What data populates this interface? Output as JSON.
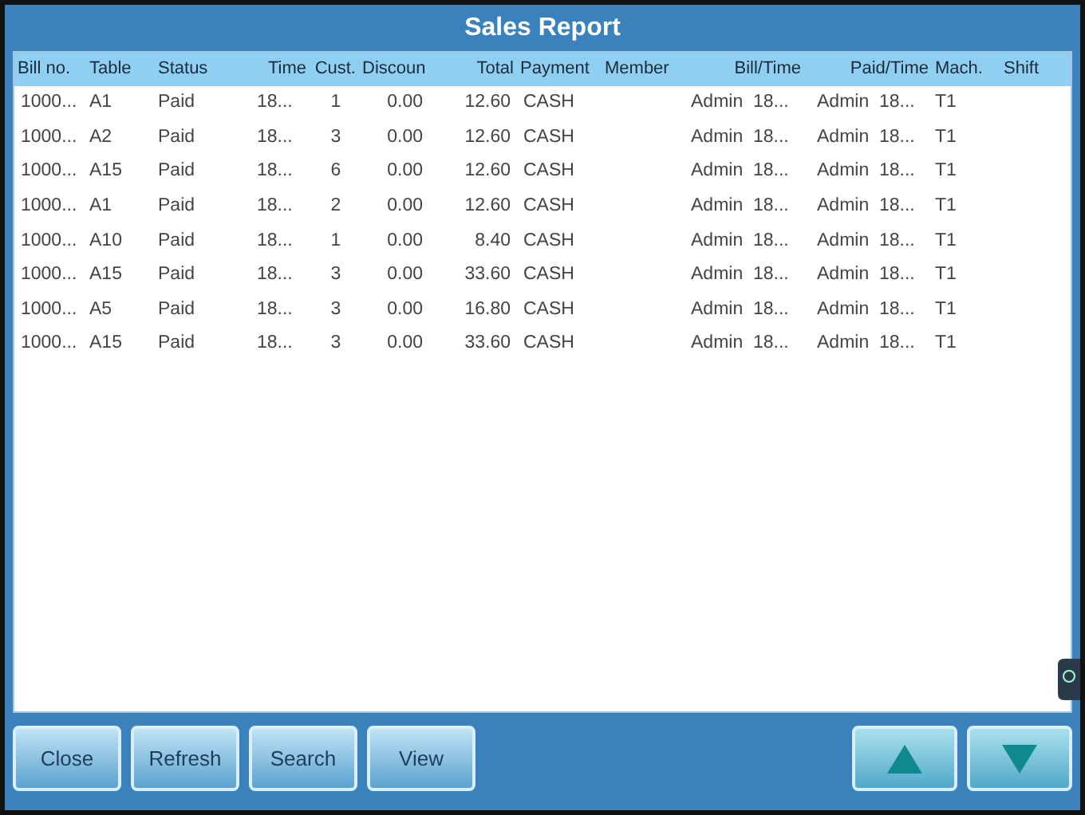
{
  "window": {
    "title": "Sales Report"
  },
  "table": {
    "columns": [
      "Bill no.",
      "Table",
      "Status",
      "Time",
      "Cust.",
      "Discoun",
      "Total",
      "Payment",
      "Member",
      "Bill/Time",
      "Paid/Time",
      "Mach.",
      "Shift"
    ],
    "rows": [
      [
        "1000...",
        "A1",
        "Paid",
        "18...",
        "1",
        "0.00",
        "12.60",
        "CASH",
        "",
        "Admin  18...",
        "Admin  18...",
        "T1",
        ""
      ],
      [
        "1000...",
        "A2",
        "Paid",
        "18...",
        "3",
        "0.00",
        "12.60",
        "CASH",
        "",
        "Admin  18...",
        "Admin  18...",
        "T1",
        ""
      ],
      [
        "1000...",
        "A15",
        "Paid",
        "18...",
        "6",
        "0.00",
        "12.60",
        "CASH",
        "",
        "Admin  18...",
        "Admin  18...",
        "T1",
        ""
      ],
      [
        "1000...",
        "A1",
        "Paid",
        "18...",
        "2",
        "0.00",
        "12.60",
        "CASH",
        "",
        "Admin  18...",
        "Admin  18...",
        "T1",
        ""
      ],
      [
        "1000...",
        "A10",
        "Paid",
        "18...",
        "1",
        "0.00",
        "8.40",
        "CASH",
        "",
        "Admin  18...",
        "Admin  18...",
        "T1",
        ""
      ],
      [
        "1000...",
        "A15",
        "Paid",
        "18...",
        "3",
        "0.00",
        "33.60",
        "CASH",
        "",
        "Admin  18...",
        "Admin  18...",
        "T1",
        ""
      ],
      [
        "1000...",
        "A5",
        "Paid",
        "18...",
        "3",
        "0.00",
        "16.80",
        "CASH",
        "",
        "Admin  18...",
        "Admin  18...",
        "T1",
        ""
      ],
      [
        "1000...",
        "A15",
        "Paid",
        "18...",
        "3",
        "0.00",
        "33.60",
        "CASH",
        "",
        "Admin  18...",
        "Admin  18...",
        "T1",
        ""
      ]
    ]
  },
  "buttons": [
    "Close",
    "Refresh",
    "Search",
    "View"
  ]
}
